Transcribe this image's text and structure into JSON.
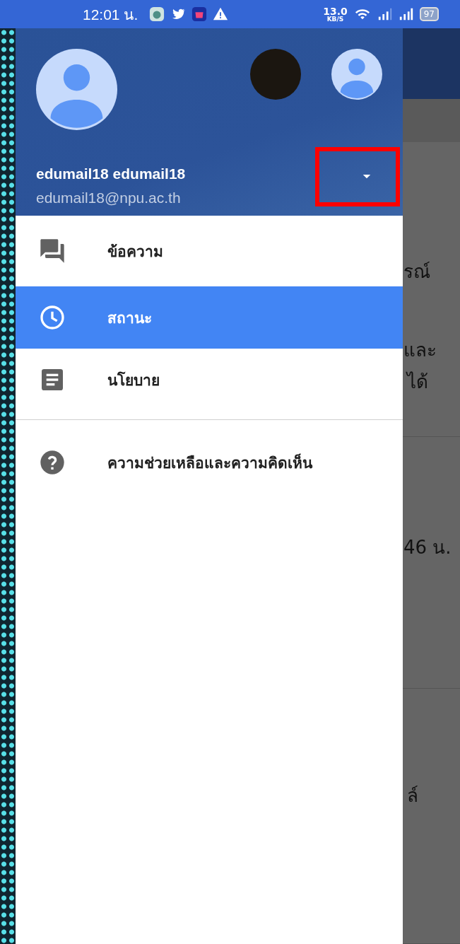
{
  "status_bar": {
    "time": "12:01 น.",
    "speed": "13.0",
    "speed_unit": "KB/S",
    "battery": "97"
  },
  "account": {
    "name": "edumail18 edumail18",
    "email": "edumail18@npu.ac.th",
    "dropdown_highlighted": true
  },
  "menu": [
    {
      "kind": "chat",
      "label": "ข้อความ",
      "selected": false
    },
    {
      "kind": "clock",
      "label": "สถานะ",
      "selected": true
    },
    {
      "kind": "doc",
      "label": "นโยบาย",
      "selected": false
    },
    {
      "kind": "divider"
    },
    {
      "kind": "help",
      "label": "ความช่วยเหลือและความคิดเห็น",
      "selected": false
    }
  ],
  "background_texts": [
    "รณ์",
    "และ",
    "ได้",
    "46 น.",
    "ล์"
  ]
}
